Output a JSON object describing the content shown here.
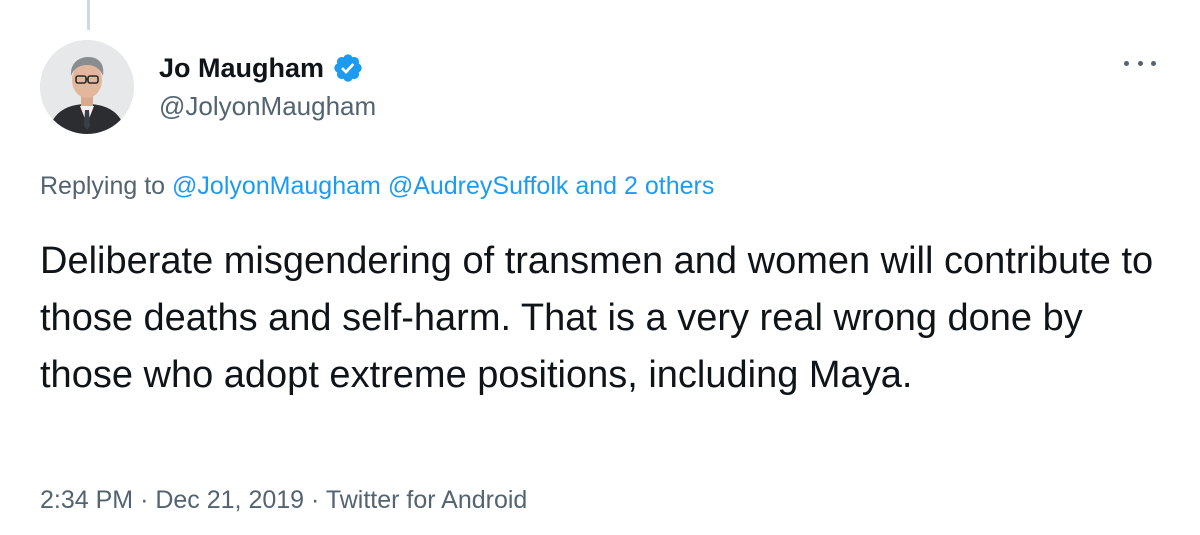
{
  "tweet": {
    "display_name": "Jo Maugham",
    "handle": "@JolyonMaugham",
    "verified_icon": "verified-badge-icon",
    "more_icon": "more-dots-icon",
    "replying_prefix": "Replying to",
    "replying_mention_1": "@JolyonMaugham",
    "replying_mention_2": "@AudreySuffolk",
    "replying_others": "and 2 others",
    "text": "Deliberate misgendering of transmen and women will contribute to those deaths and self-harm. That is a very real wrong done by those who adopt extreme positions, including Maya.",
    "time": "2:34 PM",
    "separator": "·",
    "date": "Dec 21, 2019",
    "source": "Twitter for Android"
  },
  "colors": {
    "link": "#1d9bf0",
    "secondary_text": "#536471",
    "primary_text": "#0f1419",
    "verified": "#1d9bf0",
    "thread_line": "#cfd9de"
  }
}
